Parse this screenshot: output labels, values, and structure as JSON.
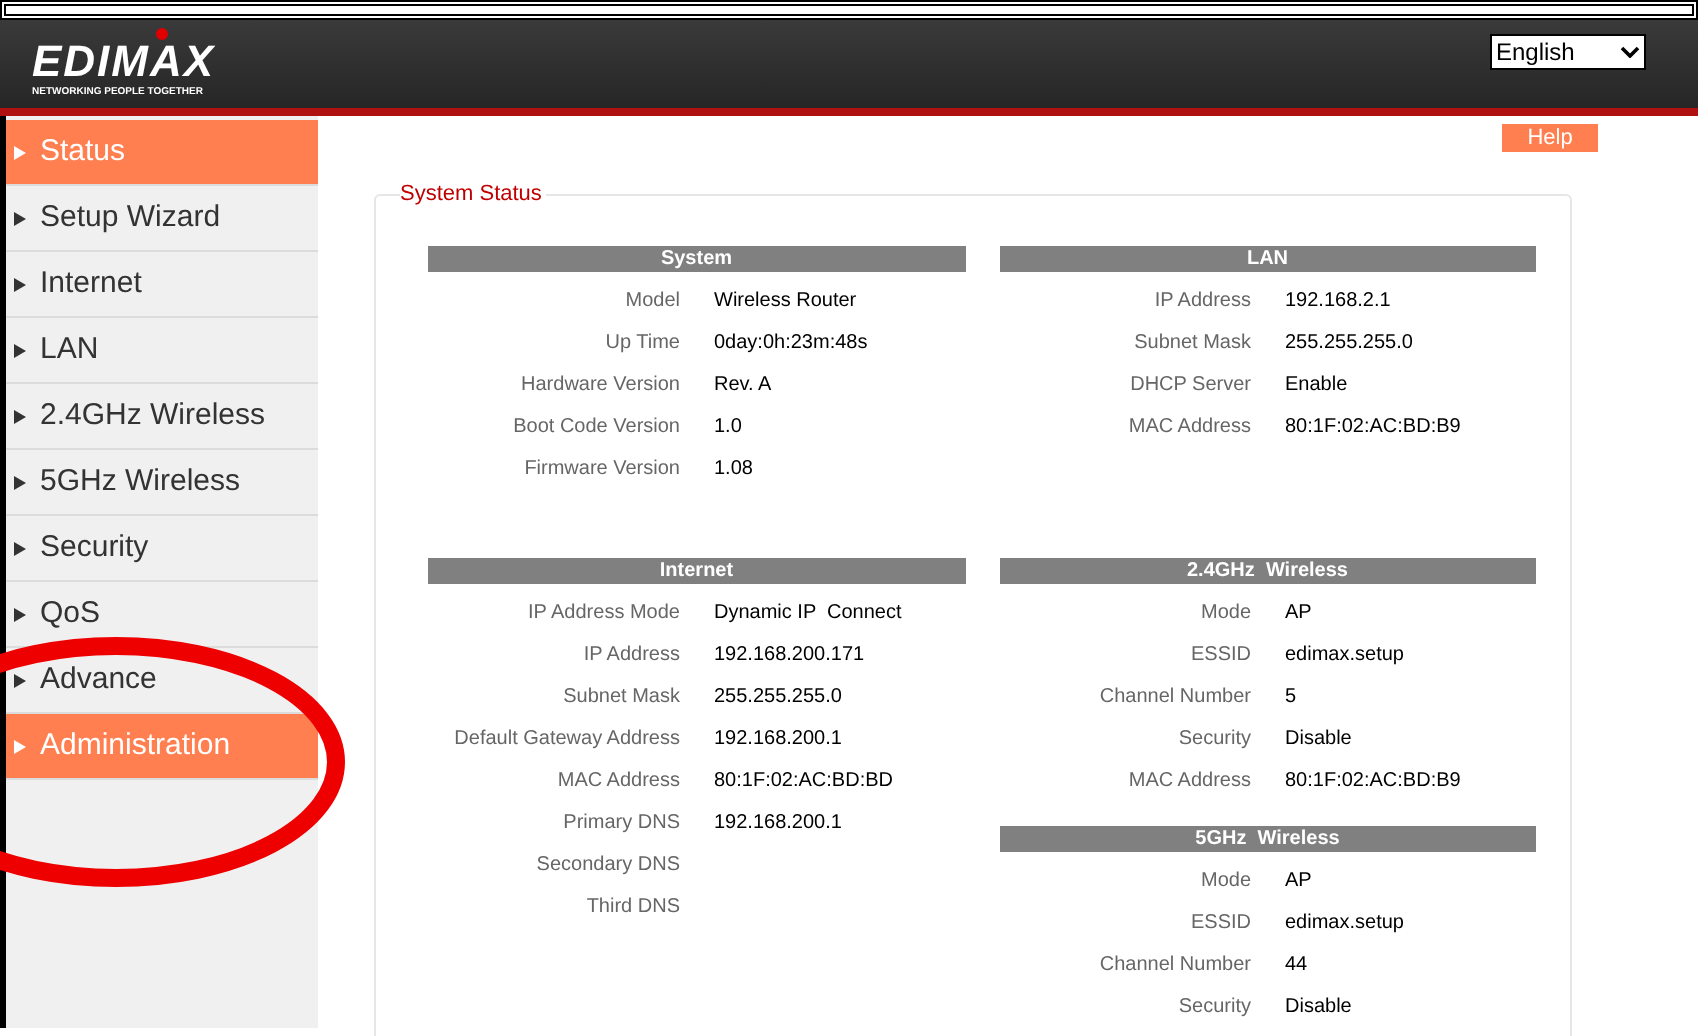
{
  "header": {
    "logo": "EDIMAX",
    "tagline": "NETWORKING PEOPLE TOGETHER",
    "language": "English"
  },
  "help": "Help",
  "sidebar": [
    {
      "label": "Status",
      "selected": true
    },
    {
      "label": "Setup Wizard",
      "selected": false
    },
    {
      "label": "Internet",
      "selected": false
    },
    {
      "label": "LAN",
      "selected": false
    },
    {
      "label": "2.4GHz Wireless",
      "selected": false
    },
    {
      "label": "5GHz Wireless",
      "selected": false
    },
    {
      "label": "Security",
      "selected": false
    },
    {
      "label": "QoS",
      "selected": false
    },
    {
      "label": "Advance",
      "selected": false
    },
    {
      "label": "Administration",
      "selected": true
    }
  ],
  "panel": {
    "title": "System Status",
    "columns": [
      [
        {
          "title": "System",
          "rows": [
            {
              "label": "Model",
              "value": "Wireless Router"
            },
            {
              "label": "Up Time",
              "value": "0day:0h:23m:48s"
            },
            {
              "label": "Hardware Version",
              "value": "Rev. A"
            },
            {
              "label": "Boot Code Version",
              "value": "1.0"
            },
            {
              "label": "Firmware Version",
              "value": "1.08"
            }
          ]
        },
        {
          "title": "Internet",
          "rows": [
            {
              "label": "IP Address Mode",
              "value": "Dynamic IP  Connect"
            },
            {
              "label": "IP Address",
              "value": "192.168.200.171"
            },
            {
              "label": "Subnet Mask",
              "value": "255.255.255.0"
            },
            {
              "label": "Default Gateway Address",
              "value": "192.168.200.1"
            },
            {
              "label": "MAC Address",
              "value": "80:1F:02:AC:BD:BD"
            },
            {
              "label": "Primary DNS",
              "value": "192.168.200.1"
            },
            {
              "label": "Secondary DNS"
            },
            {
              "label": "Third DNS"
            }
          ]
        }
      ],
      [
        {
          "title": "LAN",
          "rows": [
            {
              "label": "IP Address",
              "value": "192.168.2.1"
            },
            {
              "label": "Subnet Mask",
              "value": "255.255.255.0"
            },
            {
              "label": "DHCP Server",
              "value": "Enable"
            },
            {
              "label": "MAC Address",
              "value": "80:1F:02:AC:BD:B9"
            }
          ]
        },
        {
          "title": "2.4GHz  Wireless",
          "rows": [
            {
              "label": "Mode",
              "value": "AP"
            },
            {
              "label": "ESSID",
              "value": "edimax.setup"
            },
            {
              "label": "Channel Number",
              "value": "5"
            },
            {
              "label": "Security",
              "value": "Disable"
            },
            {
              "label": "MAC Address",
              "value": "80:1F:02:AC:BD:B9"
            }
          ]
        },
        {
          "title": "5GHz  Wireless",
          "rows": [
            {
              "label": "Mode",
              "value": "AP"
            },
            {
              "label": "ESSID",
              "value": "edimax.setup"
            },
            {
              "label": "Channel Number",
              "value": "44"
            },
            {
              "label": "Security",
              "value": "Disable"
            }
          ]
        }
      ]
    ]
  }
}
